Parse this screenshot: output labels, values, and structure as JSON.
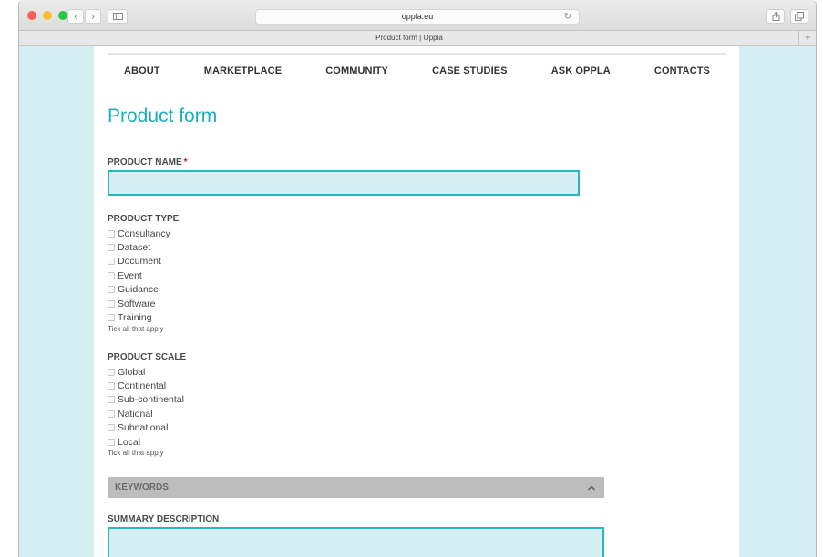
{
  "browser": {
    "url": "oppla.eu",
    "tab_title": "Product form | Oppla",
    "new_tab_symbol": "+",
    "traffic_lights": [
      "#fe5f57",
      "#febc2e",
      "#28c840"
    ],
    "icons": [
      "back-icon",
      "forward-icon",
      "sidebar-icon",
      "reload-icon",
      "share-icon",
      "tabs-icon"
    ]
  },
  "nav": {
    "items": [
      "ABOUT",
      "MARKETPLACE",
      "COMMUNITY",
      "CASE STUDIES",
      "ASK OPPLA",
      "CONTACTS"
    ]
  },
  "form": {
    "title": "Product form",
    "product_name": {
      "label": "PRODUCT NAME",
      "required_marker": "*",
      "value": ""
    },
    "product_type": {
      "label": "PRODUCT TYPE",
      "options": [
        "Consultancy",
        "Dataset",
        "Document",
        "Event",
        "Guidance",
        "Software",
        "Training"
      ],
      "help": "Tick all that apply"
    },
    "product_scale": {
      "label": "PRODUCT SCALE",
      "options": [
        "Global",
        "Continental",
        "Sub-continental",
        "National",
        "Subnational",
        "Local"
      ],
      "help": "Tick all that apply"
    },
    "keywords": {
      "label": "KEYWORDS",
      "icon": "chevron-up-icon"
    },
    "summary": {
      "label": "SUMMARY DESCRIPTION",
      "value": ""
    }
  },
  "colors": {
    "accent": "#1aaebb",
    "field_bg": "#d4eef1",
    "field_border": "#27b7bf",
    "required": "#c0152b",
    "keywords_bar": "#bdbdbd"
  }
}
